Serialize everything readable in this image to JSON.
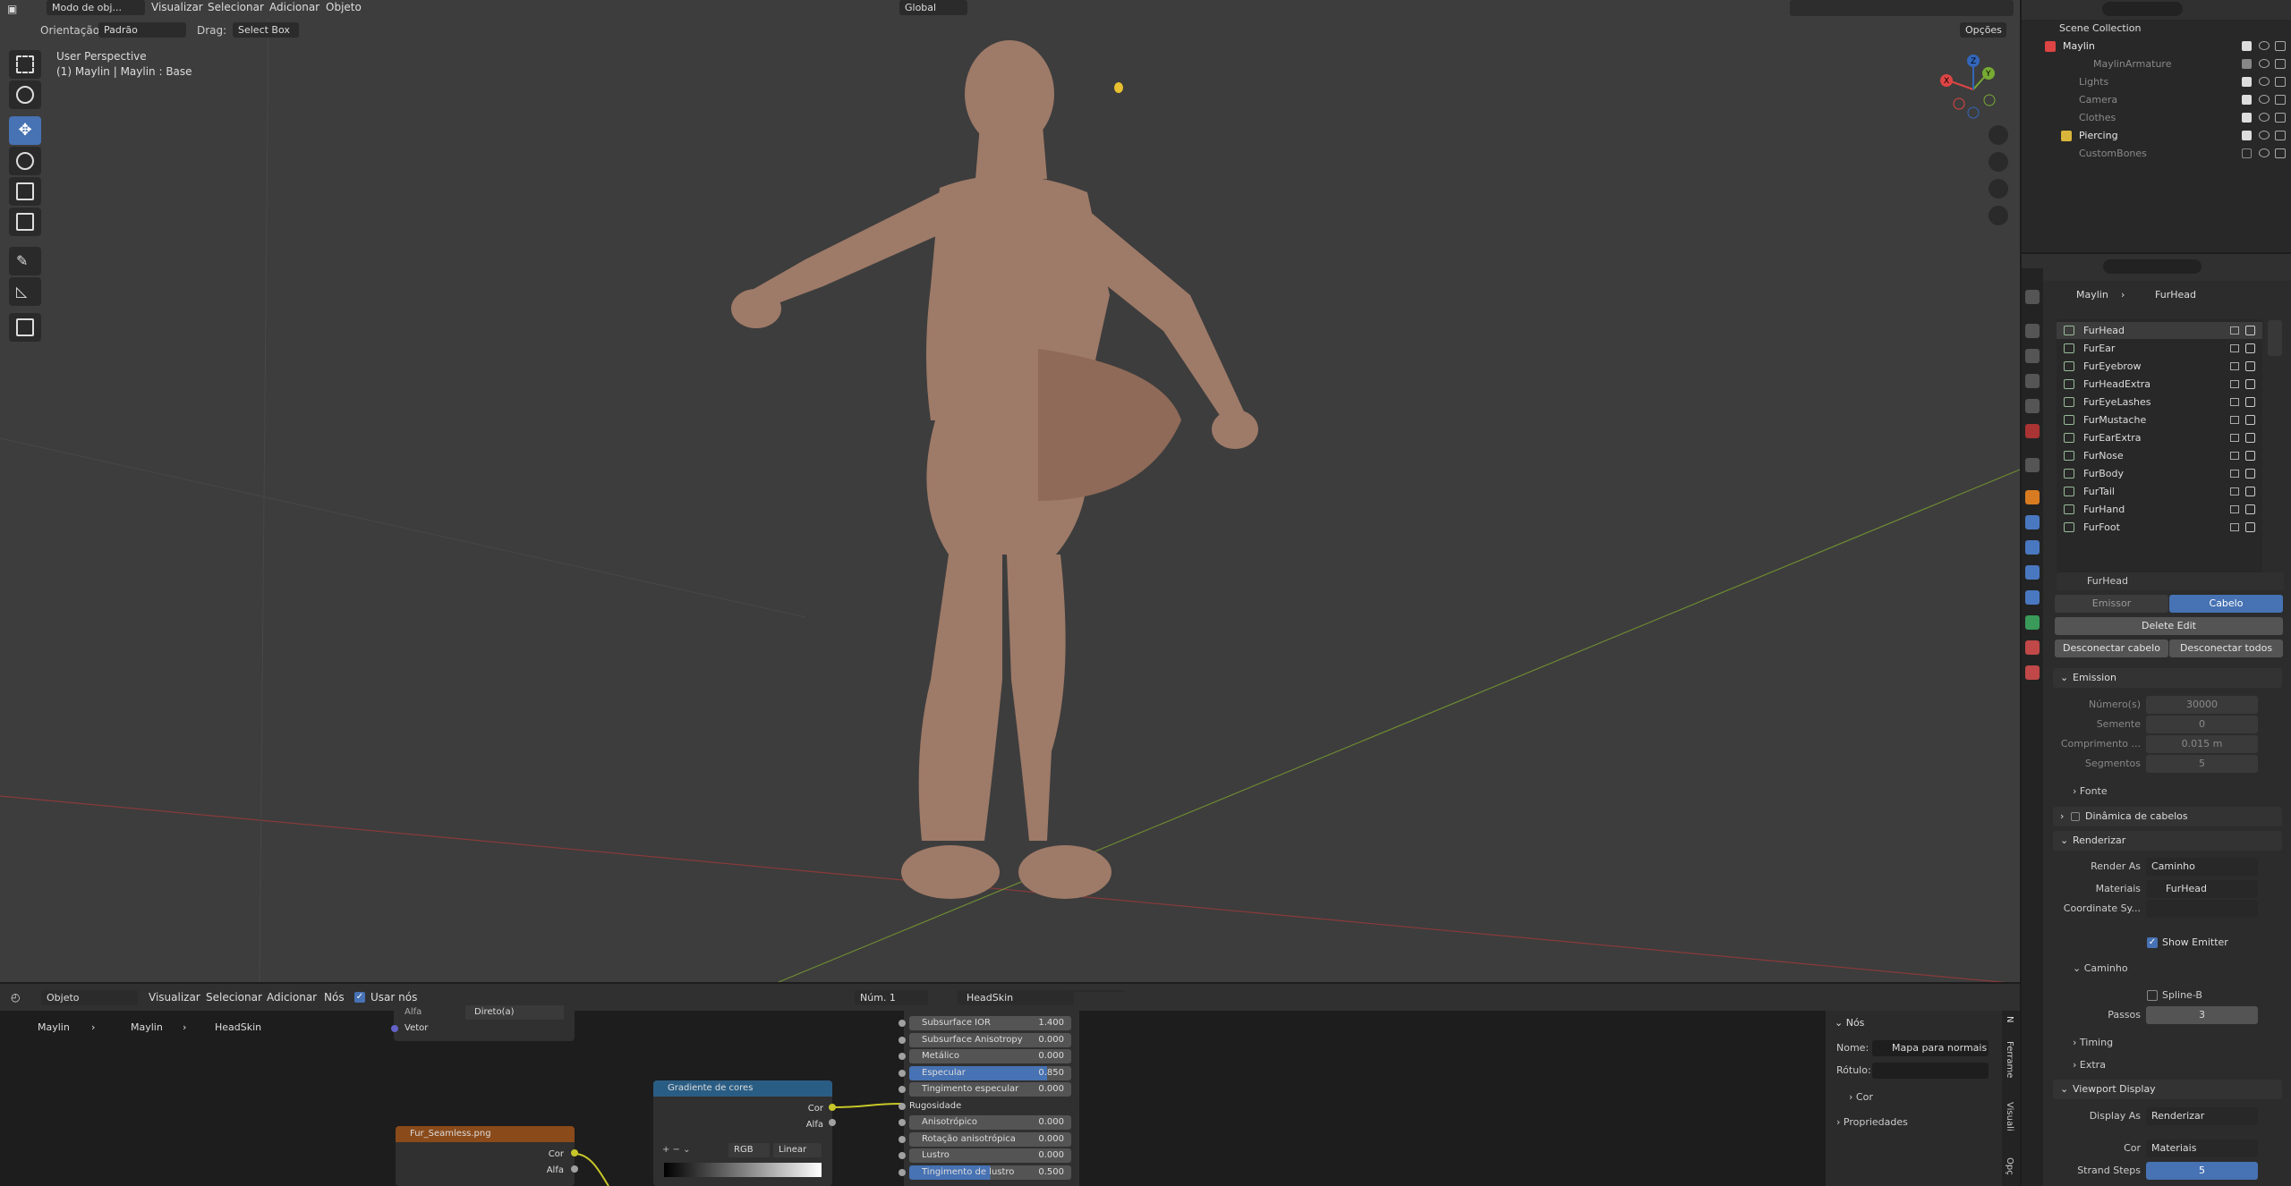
{
  "viewport": {
    "header": {
      "mode": "Modo de obj...",
      "menus": [
        "Visualizar",
        "Selecionar",
        "Adicionar",
        "Objeto"
      ],
      "orientation_label": "Orientação:",
      "orientation_value": "Padrão",
      "drag_label": "Drag:",
      "drag_value": "Select Box",
      "transform_orientation": "Global",
      "options": "Opções"
    },
    "info_line1": "User Perspective",
    "info_line2": "(1) Maylin | Maylin : Base",
    "gizmo": {
      "x": "X",
      "y": "Y",
      "z": "Z"
    }
  },
  "outliner": {
    "title": "Scene Collection",
    "items": [
      {
        "label": "Maylin",
        "dim": false
      },
      {
        "label": "MaylinArmature",
        "dim": true
      },
      {
        "label": "Lights",
        "dim": true
      },
      {
        "label": "Camera",
        "dim": true
      },
      {
        "label": "Clothes",
        "dim": true
      },
      {
        "label": "Piercing",
        "dim": false
      },
      {
        "label": "CustomBones",
        "dim": true
      }
    ]
  },
  "properties": {
    "breadcrumb": [
      "Maylin",
      "FurHead"
    ],
    "particle_systems": [
      "FurHead",
      "FurEar",
      "FurEyebrow",
      "FurHeadExtra",
      "FurEyeLashes",
      "FurMustache",
      "FurEarExtra",
      "FurNose",
      "FurBody",
      "FurTail",
      "FurHand",
      "FurFoot"
    ],
    "settings_name": "FurHead",
    "type_tabs": [
      "Emissor",
      "Cabelo"
    ],
    "delete_edit": "Delete Edit",
    "disconnect": "Desconectar cabelo",
    "disconnect_all": "Desconectar todos",
    "emission": {
      "title": "Emission",
      "rows": [
        {
          "label": "Número(s)",
          "value": "30000"
        },
        {
          "label": "Semente",
          "value": "0"
        },
        {
          "label": "Comprimento ...",
          "value": "0.015 m"
        },
        {
          "label": "Segmentos",
          "value": "5"
        }
      ],
      "fonte": "Fonte"
    },
    "dynamics": "Dinâmica de cabelos",
    "render": {
      "title": "Renderizar",
      "render_as_label": "Render As",
      "render_as": "Caminho",
      "material_label": "Materiais",
      "material": "FurHead",
      "coord_label": "Coordinate Sy...",
      "show_emitter": "Show Emitter",
      "path_title": "Caminho",
      "bspline": "Spline-B",
      "steps_label": "Passos",
      "steps": "3",
      "timing": "Timing",
      "extra": "Extra"
    },
    "viewport_display": {
      "title": "Viewport Display",
      "display_as_label": "Display As",
      "display_as": "Renderizar",
      "color_label": "Cor",
      "color": "Materiais",
      "strand_label": "Strand Steps",
      "strand": "5"
    }
  },
  "node_editor": {
    "header": {
      "mode": "Objeto",
      "menus": [
        "Visualizar",
        "Selecionar",
        "Adicionar",
        "Nós"
      ],
      "use_nodes": "Usar nós",
      "slot": "Núm. 1",
      "material": "HeadSkin"
    },
    "breadcrumb": [
      "Maylin",
      "Maylin",
      "HeadSkin"
    ],
    "node_top": {
      "alfa": "Alfa",
      "mode": "Direto(a)",
      "vetor": "Vetor"
    },
    "gradient_node": {
      "title": "Gradiente de cores",
      "out1": "Cor",
      "out2": "Alfa",
      "mode": "RGB",
      "interp": "Linear"
    },
    "texture_node": {
      "title": "Fur_Seamless.png",
      "out1": "Cor",
      "out2": "Alfa"
    },
    "bsdf_rows": [
      {
        "name": "Subsurface IOR",
        "value": "1.400",
        "fill": 0.0
      },
      {
        "name": "Subsurface Anisotropy",
        "value": "0.000",
        "fill": 0.0
      },
      {
        "name": "Metálico",
        "value": "0.000",
        "fill": 0.0
      },
      {
        "name": "Especular",
        "value": "0.850",
        "fill": 0.85
      },
      {
        "name": "Tingimento especular",
        "value": "0.000",
        "fill": 0.0
      },
      {
        "name": "Rugosidade",
        "value": "",
        "fill": 0.0
      },
      {
        "name": "Anisotrópico",
        "value": "0.000",
        "fill": 0.0
      },
      {
        "name": "Rotação anisotrópica",
        "value": "0.000",
        "fill": 0.0
      },
      {
        "name": "Lustro",
        "value": "0.000",
        "fill": 0.0
      },
      {
        "name": "Tingimento de lustro",
        "value": "0.500",
        "fill": 0.5
      }
    ],
    "sidebar": {
      "title": "Nós",
      "name_label": "Nome:",
      "name_value": "Mapa para normais",
      "label_label": "Rótulo:",
      "color": "Cor",
      "properties": "Propriedades",
      "tabs": [
        "N",
        "Ferrame",
        "Visuali",
        "Opç"
      ]
    }
  }
}
